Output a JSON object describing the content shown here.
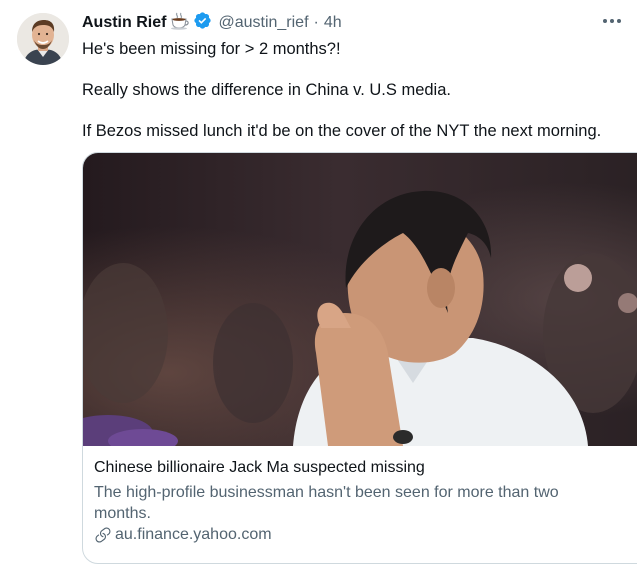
{
  "tweet": {
    "author_name": "Austin Rief",
    "author_emoji": "☕",
    "handle": "@austin_rief",
    "separator": "·",
    "time_ago": "4h",
    "lines": [
      "He's been missing for > 2 months?!",
      "Really shows the difference in China v. U.S media.",
      "If Bezos missed lunch it'd be on the cover of the NYT the next morning."
    ]
  },
  "card": {
    "title": "Chinese billionaire Jack Ma suspected missing",
    "description": "The high-profile businessman hasn't been seen for more than two months.",
    "domain": "au.finance.yahoo.com"
  },
  "icons": {
    "verified": "verified-badge-icon",
    "link": "link-icon",
    "more": "more-options-icon"
  },
  "colors": {
    "verified_blue": "#1d9bf0",
    "secondary_text": "#536471",
    "primary_text": "#0f1419",
    "card_border": "#cfd9de"
  }
}
